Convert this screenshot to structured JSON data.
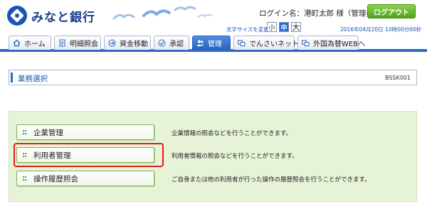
{
  "header": {
    "bank_name": "みなと銀行",
    "login_name": "ログイン名：港町太郎 様（管理者ユーザ）",
    "logout_label": "ログアウト",
    "font_size_label": "文字サイズを変更",
    "font_sizes": [
      "小",
      "中",
      "大"
    ],
    "selected_font_size": "中",
    "datetime": "2016年04月20日 10時00分00秒"
  },
  "nav": {
    "tabs": [
      {
        "label": "ホーム",
        "icon": "home-icon"
      },
      {
        "label": "明細照会",
        "icon": "document-icon"
      },
      {
        "label": "資金移動",
        "icon": "transfer-icon"
      },
      {
        "label": "承認",
        "icon": "check-icon"
      },
      {
        "label": "管理",
        "icon": "users-icon",
        "active": true
      },
      {
        "label": "でんさいネットへ",
        "icon": "window-link-icon"
      },
      {
        "label": "外国為替WEBへ",
        "icon": "window-link-icon"
      }
    ]
  },
  "page": {
    "title": "業務選択",
    "code": "BSSK001"
  },
  "menu": {
    "items": [
      {
        "label": "企業管理",
        "description": "企業情報の照会などを行うことができます。"
      },
      {
        "label": "利用者管理",
        "description": "利用者情報の照会などを行うことができます。",
        "highlighted": true
      },
      {
        "label": "操作履歴照会",
        "description": "ご自身または他の利用者が行った操作の履歴照会を行うことができます。"
      }
    ]
  },
  "colors": {
    "brand_blue": "#1a56b0",
    "nav_active": "#2a63bd",
    "panel_green": "#e6f3d6",
    "logout_green": "#4ea31d",
    "highlight_red": "#e21c1c"
  }
}
